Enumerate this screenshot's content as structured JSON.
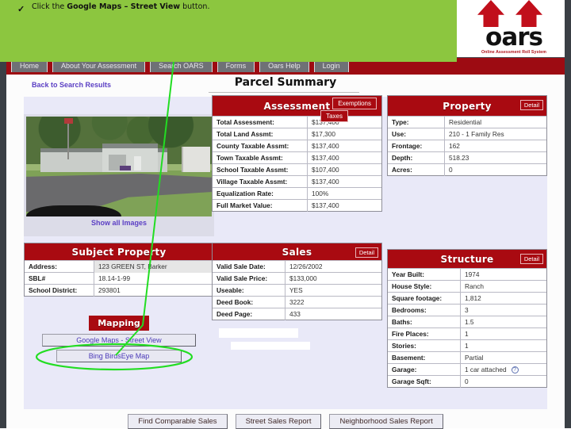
{
  "annotation": {
    "check_icon": "check-mark-icon",
    "check_glyph": "✓",
    "text_prefix": "Click the ",
    "text_bold": "Google Maps – Street View",
    "text_suffix": " button.",
    "banner_color": "#8cc63f",
    "arrow_color": "#22dd22"
  },
  "site": {
    "logo_word": "oars",
    "logo_tagline": "Online Assessment Roll System",
    "brand_red": "#a90a11",
    "nav": [
      {
        "label": "Home"
      },
      {
        "label": "About Your Assessment"
      },
      {
        "label": "Search OARS"
      },
      {
        "label": "Forms"
      },
      {
        "label": "Oars Help"
      },
      {
        "label": "Login"
      }
    ]
  },
  "page": {
    "back_link": "Back to Search Results",
    "title": "Parcel Summary",
    "show_all_images": "Show all Images"
  },
  "assessment": {
    "title": "Assessment",
    "exemptions_button": "Exemptions",
    "taxes_button": "Taxes",
    "rows": [
      {
        "label": "Total Assessment:",
        "value": "$137,400"
      },
      {
        "label": "Total Land Assmt:",
        "value": "$17,300"
      },
      {
        "label": "County Taxable Assmt:",
        "value": "$137,400"
      },
      {
        "label": "Town Taxable Assmt:",
        "value": "$137,400"
      },
      {
        "label": "School Taxable Assmt:",
        "value": "$107,400"
      },
      {
        "label": "Village Taxable Assmt:",
        "value": "$137,400"
      },
      {
        "label": "Equalization Rate:",
        "value": "100%"
      },
      {
        "label": "Full Market Value:",
        "value": "$137,400"
      }
    ]
  },
  "property": {
    "title": "Property",
    "detail_button": "Detail",
    "rows": [
      {
        "label": "Type:",
        "value": "Residential"
      },
      {
        "label": "Use:",
        "value": "210 - 1 Family Res"
      },
      {
        "label": "Frontage:",
        "value": "162"
      },
      {
        "label": "Depth:",
        "value": "518.23"
      },
      {
        "label": "Acres:",
        "value": "0"
      }
    ]
  },
  "subject_property": {
    "title": "Subject Property",
    "rows": [
      {
        "label": "Address:",
        "value": "123 GREEN ST, Barker"
      },
      {
        "label": "SBL#",
        "value": "18.14-1-99"
      },
      {
        "label": "School District:",
        "value": "293801"
      }
    ]
  },
  "sales": {
    "title": "Sales",
    "detail_button": "Detail",
    "rows": [
      {
        "label": "Valid Sale Date:",
        "value": "12/26/2002"
      },
      {
        "label": "Valid Sale Price:",
        "value": "$133,000"
      },
      {
        "label": "Useable:",
        "value": "YES"
      },
      {
        "label": "Deed Book:",
        "value": "3222"
      },
      {
        "label": "Deed Page:",
        "value": "433"
      }
    ]
  },
  "structure": {
    "title": "Structure",
    "detail_button": "Detail",
    "rows": [
      {
        "label": "Year Built:",
        "value": "1974"
      },
      {
        "label": "House Style:",
        "value": "Ranch"
      },
      {
        "label": "Square footage:",
        "value": "1,812"
      },
      {
        "label": "Bedrooms:",
        "value": "3"
      },
      {
        "label": "Baths:",
        "value": "1.5"
      },
      {
        "label": "Fire Places:",
        "value": "1"
      },
      {
        "label": "Stories:",
        "value": "1"
      },
      {
        "label": "Basement:",
        "value": "Partial"
      },
      {
        "label": "Garage:",
        "value": "1 car attached"
      },
      {
        "label": "Garage Sqft:",
        "value": "0"
      }
    ],
    "garage_help_icon": "question-mark-icon"
  },
  "mapping": {
    "title": "Mapping",
    "google_street_view": "Google Maps - Street View",
    "bing_birdseye": "Bing BirdsEye Map"
  },
  "bottom_buttons": [
    {
      "label": "Find Comparable Sales"
    },
    {
      "label": "Street Sales Report"
    },
    {
      "label": "Neighborhood Sales Report"
    }
  ]
}
